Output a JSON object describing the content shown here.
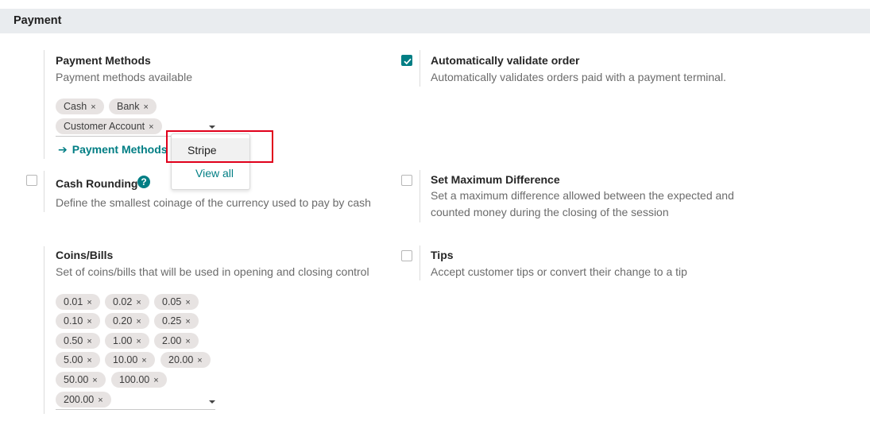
{
  "section": {
    "title": "Payment"
  },
  "payment_methods": {
    "title": "Payment Methods",
    "description": "Payment methods available",
    "tags": [
      "Cash",
      "Bank",
      "Customer Account"
    ],
    "link_label": "Payment Methods",
    "dropdown": {
      "items": [
        "Stripe"
      ],
      "view_all": "View all"
    }
  },
  "auto_validate": {
    "title": "Automatically validate order",
    "description": "Automatically validates orders paid with a payment terminal.",
    "checked": true
  },
  "cash_rounding": {
    "title": "Cash Rounding",
    "help": "?",
    "description": "Define the smallest coinage of the currency used to pay by cash",
    "checked": false
  },
  "max_difference": {
    "title": "Set Maximum Difference",
    "description_line1": "Set a maximum difference allowed between the expected and",
    "description_line2": "counted money during the closing of the session",
    "checked": false
  },
  "coins_bills": {
    "title": "Coins/Bills",
    "description": "Set of coins/bills that will be used in opening and closing control",
    "tags": [
      "0.01",
      "0.02",
      "0.05",
      "0.10",
      "0.20",
      "0.25",
      "0.50",
      "1.00",
      "2.00",
      "5.00",
      "10.00",
      "20.00",
      "50.00",
      "100.00",
      "200.00"
    ]
  },
  "tips": {
    "title": "Tips",
    "description": "Accept customer tips or convert their change to a tip",
    "checked": false
  },
  "colors": {
    "accent": "#017e84",
    "highlight": "#e0001b",
    "tag_bg": "#e7e3e2"
  },
  "icons": {
    "tag_remove": "×",
    "link_arrow": "➔",
    "checkmark": "check-icon"
  }
}
